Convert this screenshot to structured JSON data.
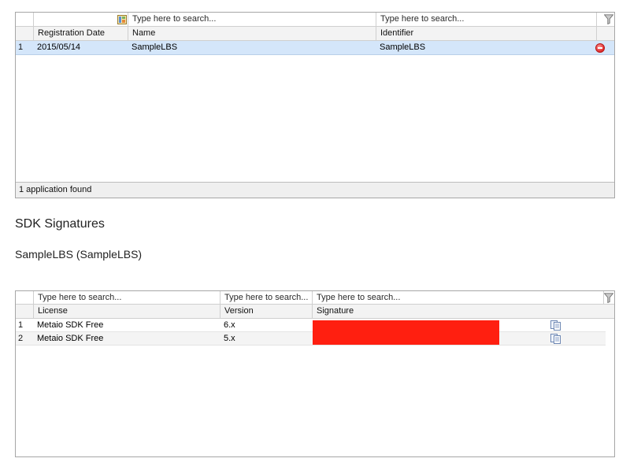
{
  "applications": {
    "filters": {
      "name_placeholder": "Type here to search...",
      "identifier_placeholder": "Type here to search..."
    },
    "columns": {
      "registration_date": "Registration Date",
      "name": "Name",
      "identifier": "Identifier"
    },
    "rows": [
      {
        "num": "1",
        "registration_date": "2015/05/14",
        "name": "SampleLBS",
        "identifier": "SampleLBS"
      }
    ],
    "footer": "1 application found"
  },
  "sdk_section": {
    "title": "SDK Signatures",
    "subtitle": "SampleLBS (SampleLBS)"
  },
  "signatures": {
    "filters": {
      "license_placeholder": "Type here to search...",
      "version_placeholder": "Type here to search...",
      "signature_placeholder": "Type here to search..."
    },
    "columns": {
      "license": "License",
      "version": "Version",
      "signature": "Signature"
    },
    "rows": [
      {
        "num": "1",
        "license": "Metaio SDK Free",
        "version": "6.x"
      },
      {
        "num": "2",
        "license": "Metaio SDK Free",
        "version": "5.x"
      }
    ]
  },
  "colors": {
    "selected_row": "#d4e6fa",
    "redaction": "#ff1f10",
    "remove_icon": "#e02828"
  }
}
